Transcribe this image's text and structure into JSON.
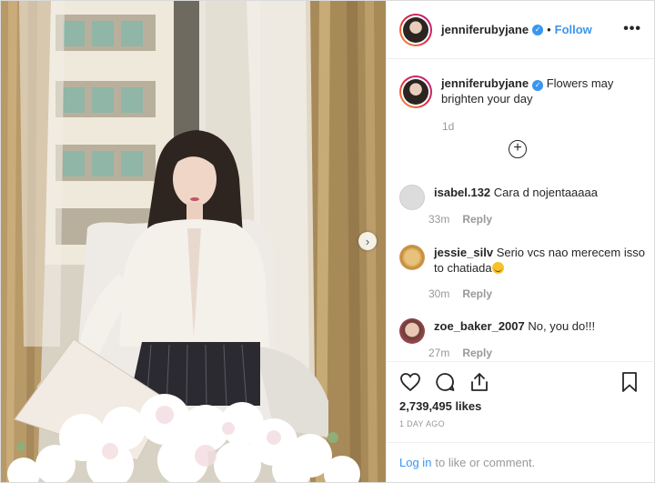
{
  "post": {
    "username": "jenniferubyjane",
    "follow_label": "Follow",
    "more_label": "•••",
    "separator": "•",
    "caption_text": "Flowers may brighten your day",
    "caption_age": "1d",
    "add_label": "+"
  },
  "comments": [
    {
      "username": "isabel.132",
      "text": "Cara d nojentaaaaa",
      "age": "33m",
      "reply": "Reply"
    },
    {
      "username": "jessie_silv",
      "text": "Serio vcs nao merecem isso to chatiada",
      "age": "30m",
      "reply": "Reply"
    },
    {
      "username": "zoe_baker_2007",
      "text": "No, you do!!!",
      "age": "27m",
      "reply": "Reply"
    }
  ],
  "stats": {
    "likes": "2,739,495 likes",
    "posted_ago": "1 DAY AGO"
  },
  "footer": {
    "login_label": "Log in",
    "login_suffix": "to like or comment."
  },
  "colors": {
    "accent": "#3897f0",
    "muted": "#999999",
    "text": "#262626"
  },
  "icons": [
    "heart-icon",
    "comment-icon",
    "share-icon",
    "bookmark-icon",
    "verified-badge-icon",
    "more-icon",
    "add-circle-icon",
    "next-arrow-icon"
  ]
}
